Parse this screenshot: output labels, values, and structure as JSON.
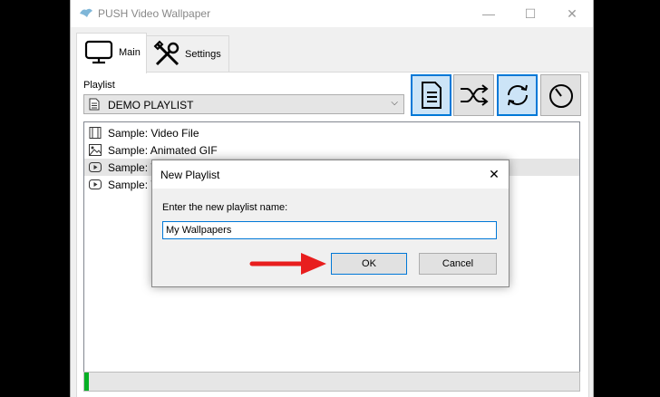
{
  "window": {
    "title": "PUSH Video Wallpaper",
    "minimize": "—",
    "maximize": "☐",
    "close": "✕"
  },
  "tabs": [
    {
      "label": "Main",
      "icon": "monitor-icon",
      "active": true
    },
    {
      "label": "Settings",
      "icon": "tools-icon",
      "active": false
    }
  ],
  "playlist": {
    "label": "Playlist",
    "selected": "DEMO PLAYLIST",
    "items": [
      {
        "label": "Sample: Video File",
        "icon": "film-icon"
      },
      {
        "label": "Sample: Animated GIF",
        "icon": "image-icon"
      },
      {
        "label": "Sample: Y",
        "icon": "youtube-icon"
      },
      {
        "label": "Sample: Y",
        "icon": "youtube-icon"
      }
    ]
  },
  "toolbar": [
    {
      "name": "playlist-button",
      "icon": "document-icon",
      "active": true
    },
    {
      "name": "shuffle-button",
      "icon": "shuffle-icon",
      "active": false
    },
    {
      "name": "repeat-button",
      "icon": "repeat-icon",
      "active": true
    },
    {
      "name": "timer-button",
      "icon": "timer-icon",
      "active": false
    }
  ],
  "progress": {
    "value": 0.01,
    "color": "#06b025"
  },
  "dialog": {
    "title": "New Playlist",
    "prompt": "Enter the new playlist name:",
    "input_value": "My Wallpapers",
    "ok_label": "OK",
    "cancel_label": "Cancel",
    "close": "✕"
  },
  "annotation": {
    "arrow_color": "#e81e1e",
    "icon": "red-arrow-icon"
  },
  "colors": {
    "accent": "#0078d7",
    "active_button": "#cce4f7"
  }
}
